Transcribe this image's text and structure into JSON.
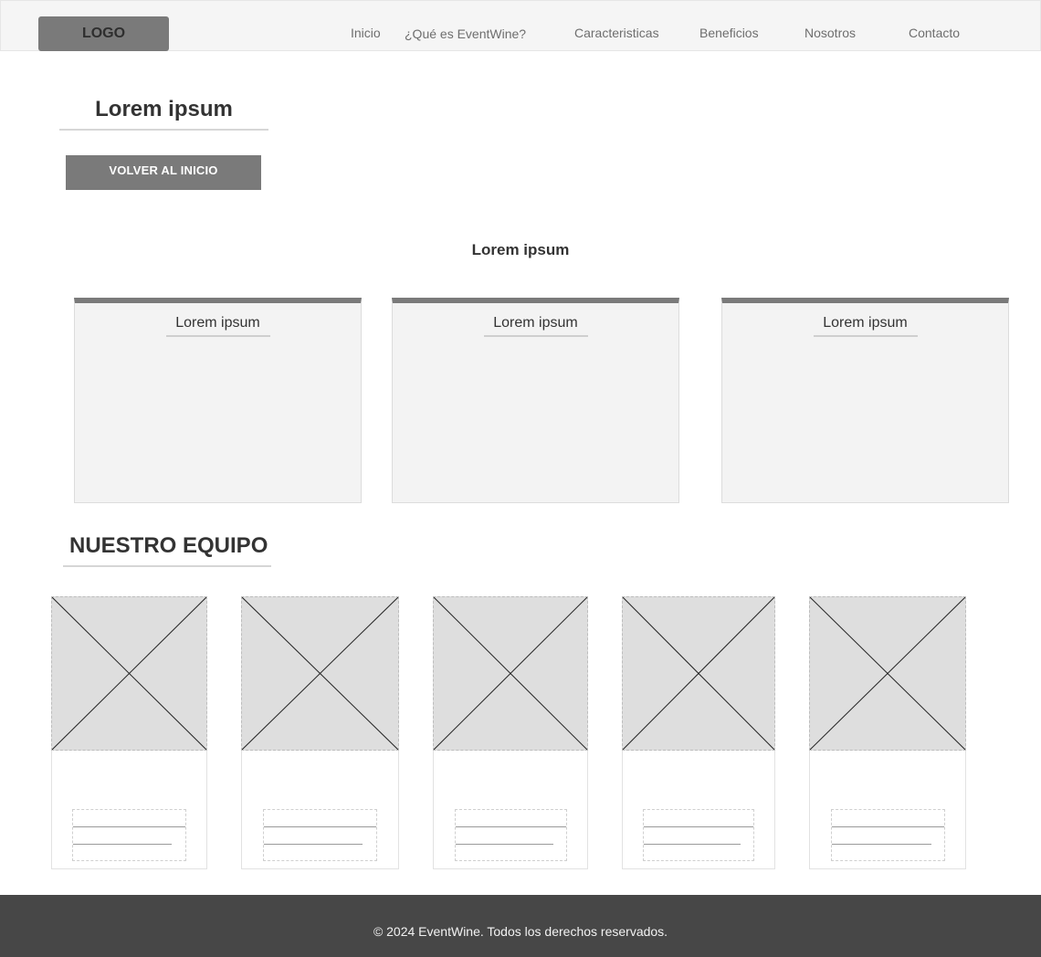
{
  "header": {
    "logo": "LOGO",
    "nav": [
      "Inicio",
      "¿Qué es EventWine?",
      "Caracteristicas",
      "Beneficios",
      "Nosotros",
      "Contacto"
    ]
  },
  "hero": {
    "title": "Lorem ipsum",
    "button": "VOLVER AL INICIO"
  },
  "section": {
    "title": "Lorem ipsum"
  },
  "cards": [
    {
      "title": "Lorem ipsum"
    },
    {
      "title": "Lorem ipsum"
    },
    {
      "title": "Lorem ipsum"
    }
  ],
  "team": {
    "title": "NUESTRO EQUIPO",
    "member_count": 5
  },
  "footer": {
    "text": "© 2024 EventWine. Todos los derechos reservados."
  }
}
